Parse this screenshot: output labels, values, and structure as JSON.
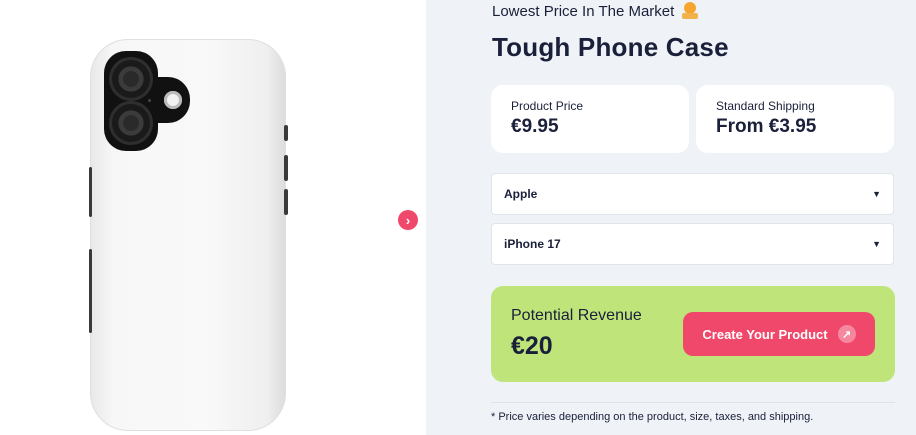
{
  "gallery": {
    "next_glyph": "›",
    "image_alt": "Tough Phone Case product image"
  },
  "header": {
    "tagline": "Lowest Price In The Market",
    "tagline_icon": "award-badge-icon",
    "title": "Tough Phone Case"
  },
  "pricing": {
    "product_price_label": "Product Price",
    "product_price_value": "€9.95",
    "shipping_label": "Standard Shipping",
    "shipping_value": "From €3.95"
  },
  "selects": {
    "brand": {
      "value": "Apple",
      "caret": "▼"
    },
    "model": {
      "value": "iPhone 17",
      "caret": "▼"
    }
  },
  "revenue": {
    "label": "Potential Revenue",
    "value": "€20",
    "cta_label": "Create Your Product",
    "cta_icon_glyph": "↗"
  },
  "footnote": "* Price varies depending on the product, size, taxes, and shipping.",
  "colors": {
    "accent": "#f0486a",
    "revenue_bg": "#bfe57a",
    "panel_bg": "#eff3f7",
    "text": "#1a1f3a"
  }
}
